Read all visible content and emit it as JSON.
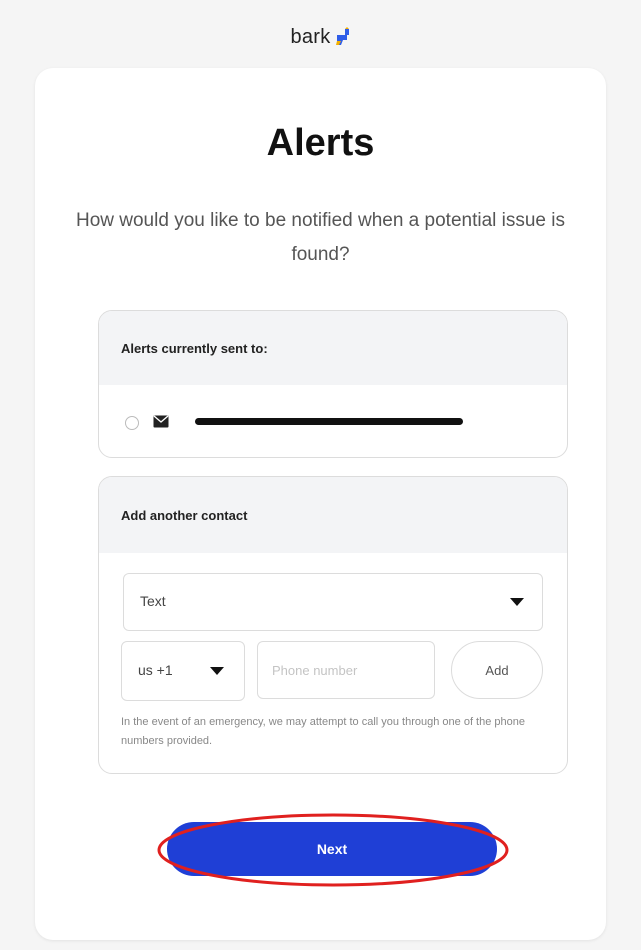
{
  "header": {
    "logo_text": "bark"
  },
  "page": {
    "title": "Alerts",
    "subtitle": "How would you like to be notified when a potential issue is found?"
  },
  "current_alerts": {
    "heading": "Alerts currently sent to:",
    "contact_icon": "mail-icon"
  },
  "add_contact": {
    "heading": "Add another contact",
    "method_selected": "Text",
    "country_code_selected": "us +1",
    "phone_placeholder": "Phone number",
    "add_label": "Add",
    "disclaimer": "In the event of an emergency, we may attempt to call you through one of the phone numbers provided."
  },
  "actions": {
    "next_label": "Next"
  },
  "colors": {
    "primary_button": "#1f3fd6",
    "logo_accent": "#2f5de8",
    "annotation": "#e0201f"
  }
}
